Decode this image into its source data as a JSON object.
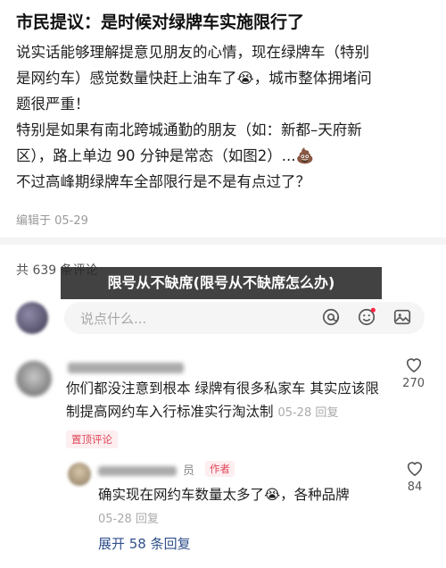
{
  "post": {
    "title": "市民提议：是时候对绿牌车实施限行了",
    "body_lines": [
      "说实话能够理解提意见朋友的心情，现在绿牌车（特别",
      "是网约车）感觉数量快赶上油车了😭，城市整体拥堵问",
      "题很严重！",
      "特别是如果有南北跨城通勤的朋友（如：新都–天府新",
      "区），路上单边 90 分钟是常态（如图2）...💩",
      "不过高峰期绿牌车全部限行是不是有点过了？"
    ],
    "edited": "编辑于 05-29"
  },
  "comments_header": {
    "count_label": "共 639 条评论"
  },
  "overlay": {
    "banner": "限号从不缺席(限号从不缺席怎么办)"
  },
  "input": {
    "placeholder": "说点什么..."
  },
  "icons": {
    "at": "at-icon",
    "emoji": "emoji-icon",
    "image": "image-icon",
    "like": "heart-icon"
  },
  "colors": {
    "accent_red": "#e04a5a",
    "link_blue": "#31508c",
    "notification_dot": "#ff2442"
  },
  "comment1": {
    "text": "你们都没注意到根本  绿牌有很多私家车  其实应该限制提高网约车入行标准实行淘汰制",
    "date": "05-28 回复",
    "pinned": "置顶评论",
    "likes": "270"
  },
  "reply1": {
    "author_suffix": "员",
    "author_tag": "作者",
    "text": "确实现在网约车数量太多了😭，各种品牌",
    "date": "05-28 回复",
    "likes": "84"
  },
  "expand": {
    "label": "展开 58 条回复"
  }
}
